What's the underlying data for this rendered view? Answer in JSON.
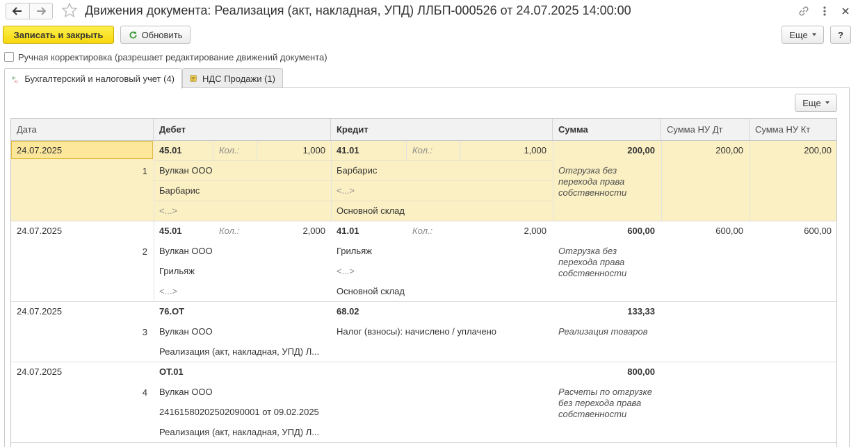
{
  "window": {
    "title": "Движения документа: Реализация (акт, накладная, УПД) ЛЛБП-000526 от 24.07.2025 14:00:00"
  },
  "toolbar": {
    "save_close_label": "Записать и закрыть",
    "refresh_label": "Обновить",
    "more_label": "Еще",
    "help_label": "?"
  },
  "manual_correction": {
    "label": "Ручная корректировка (разрешает редактирование движений документа)",
    "checked": false
  },
  "tabs": [
    {
      "label": "Бухгалтерский и налоговый учет (4)",
      "icon": "dt-kt-icon",
      "active": true
    },
    {
      "label": "НДС Продажи (1)",
      "icon": "register-icon",
      "active": false
    }
  ],
  "panel": {
    "more_label": "Еще"
  },
  "table": {
    "columns": [
      "Дата",
      "Дебет",
      "Кредит",
      "Сумма",
      "Сумма НУ Дт",
      "Сумма НУ Кт"
    ],
    "qty_label": "Кол.:",
    "rows": [
      {
        "date": "24.07.2025",
        "num": "1",
        "debit_account": "45.01",
        "debit_qty": "1,000",
        "debit_sub": [
          "Вулкан ООО",
          "Барбарис",
          "<...>"
        ],
        "credit_account": "41.01",
        "credit_qty": "1,000",
        "credit_sub": [
          "Барбарис",
          "<...>",
          "Основной склад"
        ],
        "sum": "200,00",
        "content": "Отгрузка без перехода права собственности",
        "nu_dt": "200,00",
        "nu_kt": "200,00"
      },
      {
        "date": "24.07.2025",
        "num": "2",
        "debit_account": "45.01",
        "debit_qty": "2,000",
        "debit_sub": [
          "Вулкан ООО",
          "Грильяж",
          "<...>"
        ],
        "credit_account": "41.01",
        "credit_qty": "2,000",
        "credit_sub": [
          "Грильяж",
          "<...>",
          "Основной склад"
        ],
        "sum": "600,00",
        "content": "Отгрузка без перехода права собственности",
        "nu_dt": "600,00",
        "nu_kt": "600,00"
      },
      {
        "date": "24.07.2025",
        "num": "3",
        "debit_account": "76.ОТ",
        "debit_sub": [
          "Вулкан ООО",
          "Реализация (акт, накладная, УПД) Л..."
        ],
        "credit_account": "68.02",
        "credit_sub": [
          "Налог (взносы): начислено / уплачено"
        ],
        "sum": "133,33",
        "content": "Реализация товаров"
      },
      {
        "date": "24.07.2025",
        "num": "4",
        "debit_account": "ОТ.01",
        "debit_sub": [
          "Вулкан ООО",
          "24161580202502090001 от 09.02.2025",
          "Реализация (акт, накладная, УПД) Л..."
        ],
        "sum": "800,00",
        "content": "Расчеты по отгрузке без перехода права собственности"
      }
    ]
  }
}
